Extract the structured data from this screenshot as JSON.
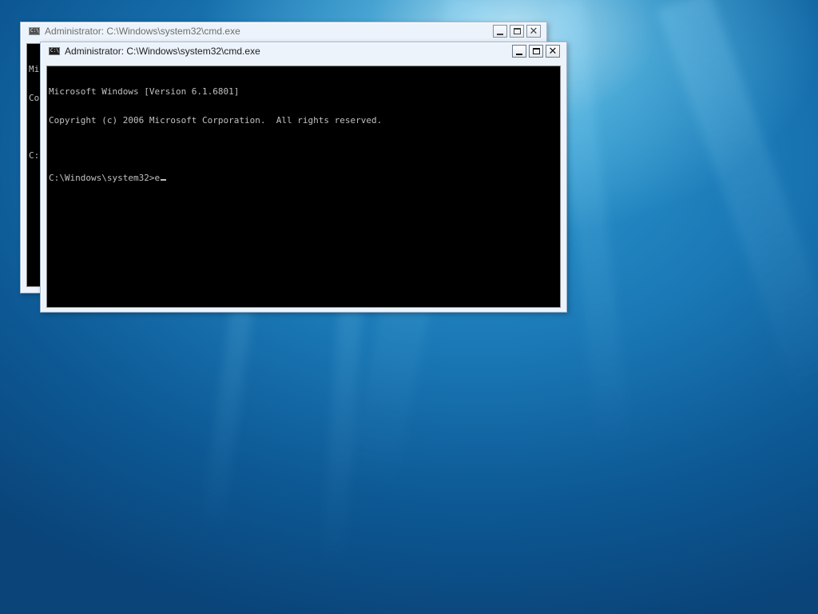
{
  "back_window": {
    "title": "Administrator: C:\\Windows\\system32\\cmd.exe",
    "icon_text": "C:\\.",
    "visible_lines": [
      "Mi",
      "Co",
      "",
      "C:"
    ],
    "controls": {
      "minimize": "minimize-icon",
      "maximize": "maximize-icon",
      "close": "✕"
    }
  },
  "front_window": {
    "title": "Administrator: C:\\Windows\\system32\\cmd.exe",
    "icon_text": "C:\\.",
    "lines": [
      "Microsoft Windows [Version 6.1.6801]",
      "Copyright (c) 2006 Microsoft Corporation.  All rights reserved.",
      ""
    ],
    "prompt": "C:\\Windows\\system32>",
    "input": "e",
    "controls": {
      "minimize": "minimize-icon",
      "maximize": "maximize-icon",
      "close": "✕"
    }
  },
  "colors": {
    "console_bg": "#000000",
    "console_text": "#c0c0c0",
    "desktop_accent": "#1a78b5",
    "frame": "#ecf3fb"
  }
}
